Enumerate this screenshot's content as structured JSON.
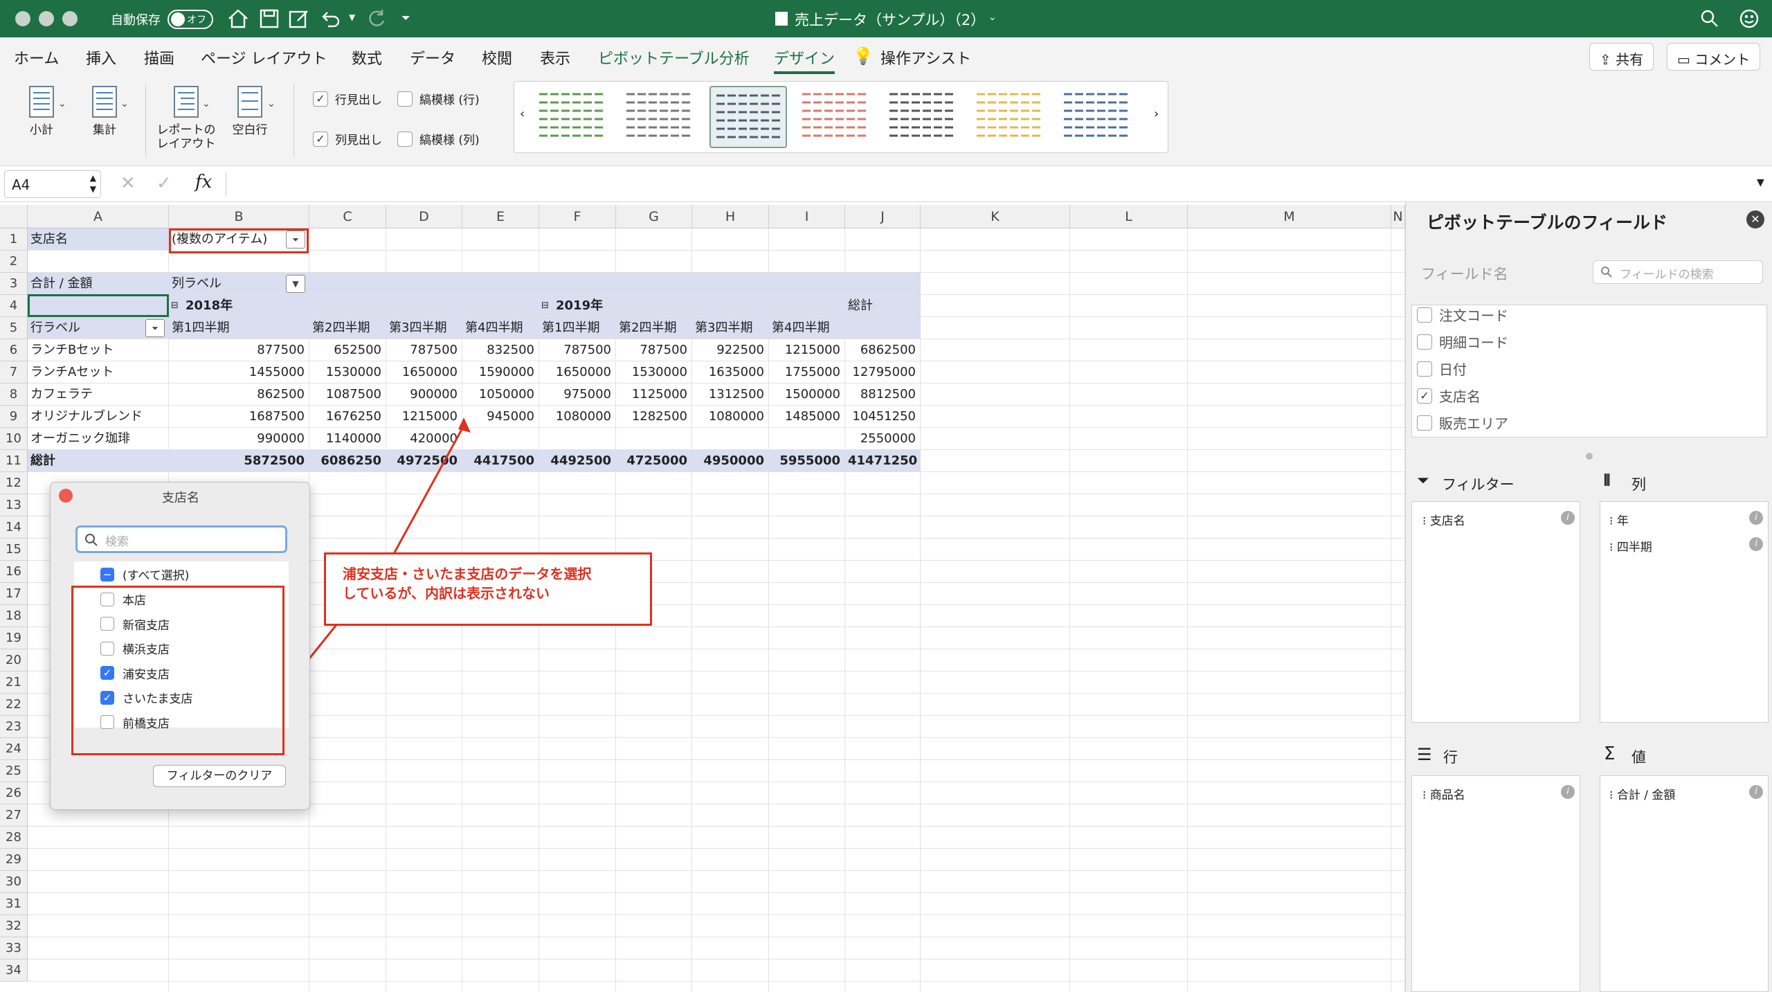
{
  "window": {
    "title": "売上データ（サンプル）（2）",
    "autosave_label": "自動保存",
    "autosave_state": "オフ"
  },
  "menu": {
    "items": [
      "ホーム",
      "挿入",
      "描画",
      "ページ レイアウト",
      "数式",
      "データ",
      "校閲",
      "表示",
      "ピボットテーブル分析",
      "デザイン",
      "操作アシスト"
    ],
    "active": "デザイン",
    "share": "共有",
    "comment": "コメント"
  },
  "ribbon": {
    "subtotal": "小計",
    "grandtotal": "集計",
    "report_layout_1": "レポートの",
    "report_layout_2": "レイアウト",
    "blank_rows": "空白行",
    "row_headers": "行見出し",
    "col_headers": "列見出し",
    "banded_rows": "縞模様 (行)",
    "banded_cols": "縞模様 (列)"
  },
  "formula": {
    "cell_ref": "A4",
    "fx": "fx"
  },
  "columns": [
    "A",
    "B",
    "C",
    "D",
    "E",
    "F",
    "G",
    "H",
    "I",
    "J",
    "K",
    "L",
    "M",
    "N"
  ],
  "rows": [
    "1",
    "2",
    "3",
    "4",
    "5",
    "6",
    "7",
    "8",
    "9",
    "10",
    "11",
    "12",
    "13",
    "14",
    "15",
    "16",
    "17",
    "18",
    "19",
    "20",
    "21",
    "22",
    "23",
    "24",
    "25",
    "26",
    "27",
    "28",
    "29",
    "30",
    "31",
    "32",
    "33",
    "34"
  ],
  "pivot": {
    "filter_label": "支店名",
    "filter_value": "(複数のアイテム)",
    "sum_label": "合計 / 金額",
    "col_label": "列ラベル",
    "row_label": "行ラベル",
    "year1": "2018年",
    "year2": "2019年",
    "grand": "総計",
    "quarters": [
      "第1四半期",
      "第2四半期",
      "第3四半期",
      "第4四半期",
      "第1四半期",
      "第2四半期",
      "第3四半期",
      "第4四半期"
    ],
    "data": [
      {
        "name": "ランチBセット",
        "v": [
          "877500",
          "652500",
          "787500",
          "832500",
          "787500",
          "787500",
          "922500",
          "1215000",
          "6862500"
        ]
      },
      {
        "name": "ランチAセット",
        "v": [
          "1455000",
          "1530000",
          "1650000",
          "1590000",
          "1650000",
          "1530000",
          "1635000",
          "1755000",
          "12795000"
        ]
      },
      {
        "name": "カフェラテ",
        "v": [
          "862500",
          "1087500",
          "900000",
          "1050000",
          "975000",
          "1125000",
          "1312500",
          "1500000",
          "8812500"
        ]
      },
      {
        "name": "オリジナルブレンド",
        "v": [
          "1687500",
          "1676250",
          "1215000",
          "945000",
          "1080000",
          "1282500",
          "1080000",
          "1485000",
          "10451250"
        ]
      },
      {
        "name": "オーガニック珈琲",
        "v": [
          "990000",
          "1140000",
          "420000",
          "",
          "",
          "",
          "",
          "",
          "2550000"
        ]
      }
    ],
    "total_label": "総計",
    "totals": [
      "5872500",
      "6086250",
      "4972500",
      "4417500",
      "4492500",
      "4725000",
      "4950000",
      "5955000",
      "41471250"
    ]
  },
  "popup": {
    "title": "支店名",
    "search_placeholder": "検索",
    "select_all": "(すべて選択)",
    "items": [
      {
        "label": "本店",
        "checked": false
      },
      {
        "label": "新宿支店",
        "checked": false
      },
      {
        "label": "横浜支店",
        "checked": false
      },
      {
        "label": "浦安支店",
        "checked": true
      },
      {
        "label": "さいたま支店",
        "checked": true
      },
      {
        "label": "前橋支店",
        "checked": false
      }
    ],
    "clear": "フィルターのクリア"
  },
  "callout": {
    "line1": "浦安支店・さいたま支店のデータを選択",
    "line2": "しているが、内訳は表示されない"
  },
  "panel": {
    "title": "ピボットテーブルのフィールド",
    "field_name": "フィールド名",
    "search_placeholder": "フィールドの検索",
    "fields": [
      {
        "label": "注文コード",
        "checked": false
      },
      {
        "label": "明細コード",
        "checked": false
      },
      {
        "label": "日付",
        "checked": false
      },
      {
        "label": "支店名",
        "checked": true
      },
      {
        "label": "販売エリア",
        "checked": false
      }
    ],
    "filters_label": "フィルター",
    "columns_label": "列",
    "rows_label": "行",
    "values_label": "値",
    "filter_items": [
      "支店名"
    ],
    "column_items": [
      "年",
      "四半期"
    ],
    "row_items": [
      "商品名"
    ],
    "value_items": [
      "合計 / 金額"
    ]
  },
  "colors": {
    "accent": "#1e7044",
    "band": "#d9def0",
    "red": "#e0301e",
    "check": "#3478f6"
  }
}
